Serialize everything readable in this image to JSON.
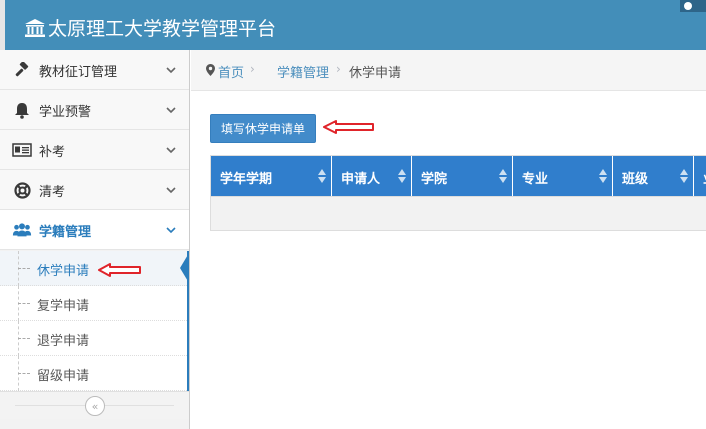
{
  "header": {
    "title": "太原理工大学教学管理平台"
  },
  "sidebar": {
    "items": [
      {
        "label": "教材征订管理",
        "icon": "gavel-icon"
      },
      {
        "label": "学业预警",
        "icon": "bell-icon"
      },
      {
        "label": "补考",
        "icon": "id-card-icon"
      },
      {
        "label": "清考",
        "icon": "life-ring-icon"
      },
      {
        "label": "学籍管理",
        "icon": "users-icon"
      }
    ],
    "submenu": [
      {
        "label": "休学申请"
      },
      {
        "label": "复学申请"
      },
      {
        "label": "退学申请"
      },
      {
        "label": "留级申请"
      }
    ],
    "collapse_icon": "«"
  },
  "breadcrumb": {
    "home": "首页",
    "section": "学籍管理",
    "current": "休学申请",
    "separator": "›"
  },
  "main": {
    "apply_button": "填写休学申请单",
    "table": {
      "columns": [
        "学年学期",
        "申请人",
        "学院",
        "专业",
        "班级",
        "业"
      ]
    }
  },
  "colors": {
    "header": "#438eb9",
    "table_header": "#307ecc",
    "button": "#428bca",
    "annotation_arrow": "#e0242a"
  }
}
